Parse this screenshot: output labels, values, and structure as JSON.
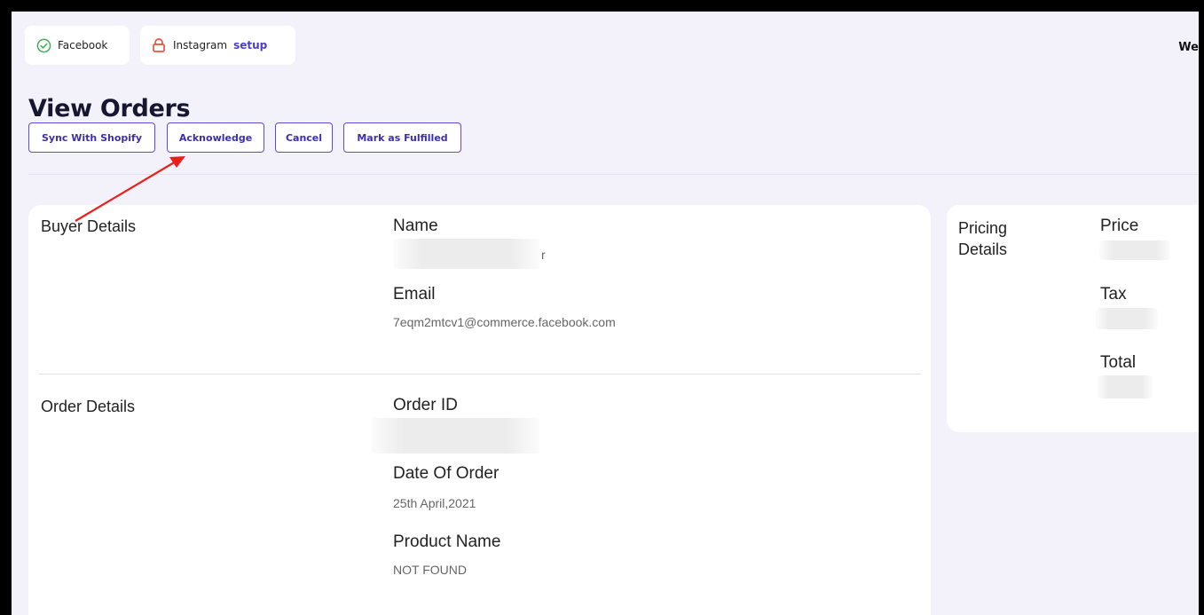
{
  "header": {
    "channels": [
      {
        "label": "Facebook",
        "icon": "check-circle-icon",
        "color": "#3fae5a"
      },
      {
        "label": "Instagram",
        "link": "setup",
        "icon": "lock-icon",
        "color": "#e8523f"
      }
    ],
    "welcome_text": "We"
  },
  "page_title": "View Orders",
  "actions": {
    "sync": "Sync With Shopify",
    "acknowledge": "Acknowledge",
    "cancel": "Cancel",
    "fulfill": "Mark as Fulfilled"
  },
  "buyer": {
    "section_title": "Buyer Details",
    "name_label": "Name",
    "name_value_visible": "r",
    "email_label": "Email",
    "email_value": "7eqm2mtcv1@commerce.facebook.com"
  },
  "order": {
    "section_title": "Order Details",
    "id_label": "Order ID",
    "date_label": "Date Of Order",
    "date_value": "25th April,2021",
    "product_label": "Product Name",
    "product_value": "NOT FOUND"
  },
  "pricing": {
    "section_title_line1": "Pricing",
    "section_title_line2": "Details",
    "price_label": "Price",
    "tax_label": "Tax",
    "total_label": "Total"
  },
  "colors": {
    "accent": "#5b4ce0",
    "background": "#f3f2fb",
    "annotation_arrow": "#e8201c"
  }
}
